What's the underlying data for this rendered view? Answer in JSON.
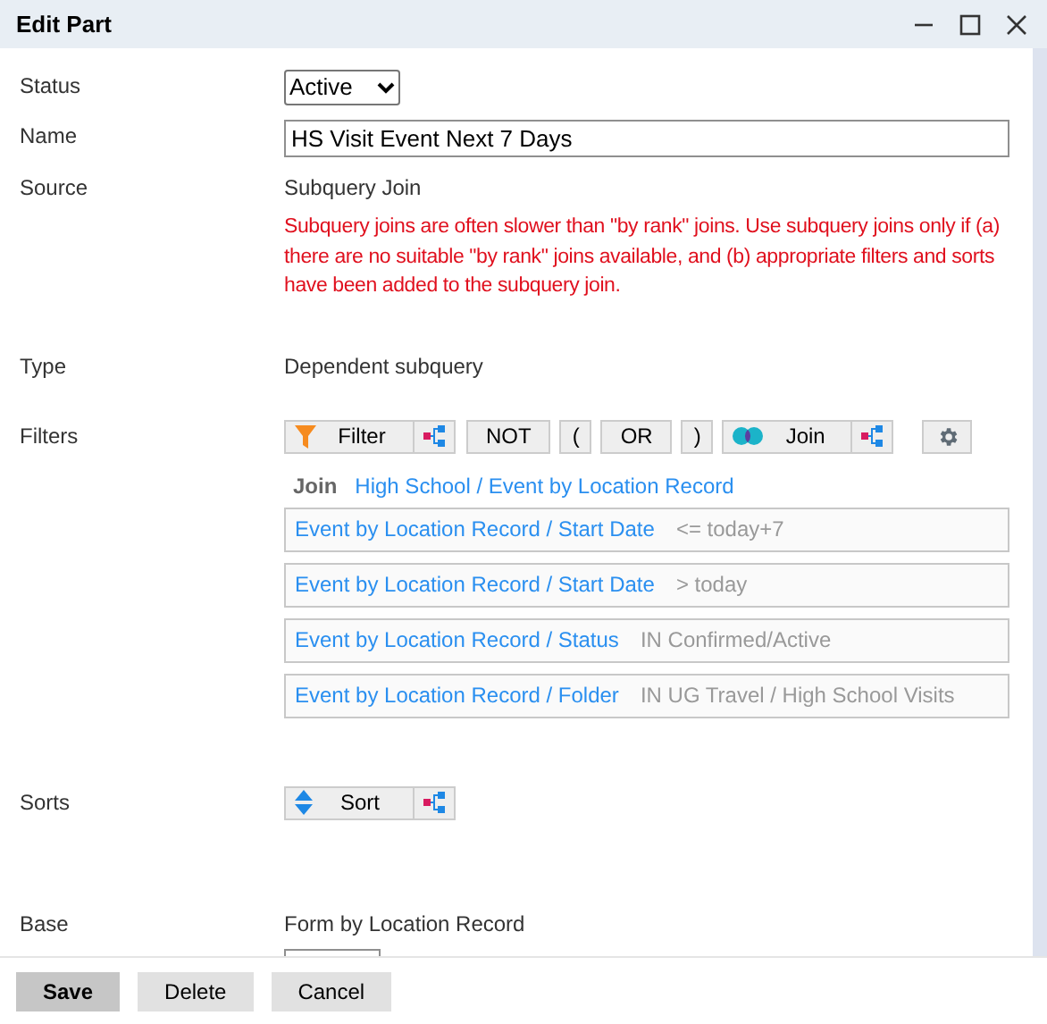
{
  "window": {
    "title": "Edit Part"
  },
  "fields": [
    {
      "label": "Status",
      "kind": "select",
      "value": "Active"
    },
    {
      "label": "Name",
      "kind": "input",
      "value": "HS Visit Event Next 7 Days"
    },
    {
      "label": "Source",
      "kind": "text",
      "value": "Subquery Join",
      "warning": "Subquery joins are often slower than \"by rank\" joins. Use subquery joins only if (a) there are no suitable \"by rank\" joins available, and (b) appropriate filters and sorts have been added to the subquery join."
    },
    {
      "label": "Type",
      "kind": "text",
      "value": "Dependent subquery"
    }
  ],
  "filters": {
    "label": "Filters",
    "toolbar": [
      {
        "kind": "filter",
        "label": "Filter"
      },
      {
        "kind": "plain",
        "label": "NOT"
      },
      {
        "kind": "plain",
        "label": "("
      },
      {
        "kind": "plain",
        "label": "OR"
      },
      {
        "kind": "plain",
        "label": ")"
      },
      {
        "kind": "join",
        "label": "Join"
      },
      {
        "kind": "gear"
      }
    ],
    "join": {
      "label": "Join",
      "path": "High School / Event by Location Record"
    },
    "conditions": [
      {
        "field": "Event by Location Record / Start Date",
        "condition": "<= today+7"
      },
      {
        "field": "Event by Location Record / Start Date",
        "condition": "> today"
      },
      {
        "field": "Event by Location Record / Status",
        "condition": "IN Confirmed/Active"
      },
      {
        "field": "Event by Location Record / Folder",
        "condition": "IN UG Travel / High School Visits"
      }
    ]
  },
  "sorts": {
    "label": "Sorts",
    "toolbar": [
      {
        "kind": "sort",
        "label": "Sort"
      }
    ]
  },
  "base": {
    "label": "Base",
    "value": "Form by Location Record"
  },
  "buttons": [
    {
      "label": "Save",
      "default": true
    },
    {
      "label": "Delete",
      "default": false
    },
    {
      "label": "Cancel",
      "default": false
    }
  ]
}
